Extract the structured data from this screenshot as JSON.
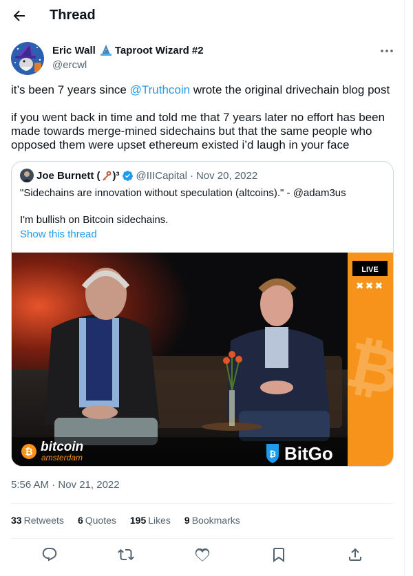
{
  "header": {
    "title": "Thread"
  },
  "author": {
    "name": "Eric Wall",
    "name_suffix": "Taproot Wizard #2",
    "handle": "@ercwl"
  },
  "tweet": {
    "line1_pre": "it’s been 7 years since ",
    "line1_mention": "@Truthcoin",
    "line1_post": " wrote the original drivechain blog post",
    "paragraph2": "if you went back in time and told me that 7 years later no effort has been made towards merge-mined sidechains but that the same people who opposed them were upset ethereum existed i’d laugh in your face"
  },
  "quote": {
    "author_name": "Joe Burnett (",
    "author_name_close": ")³",
    "handle": "@IIICapital",
    "separator": "·",
    "date": "Nov 20, 2022",
    "text1": "\"Sidechains are innovation without speculation (altcoins).\" - @adam3us",
    "text2": "I'm bullish on Bitcoin sidechains.",
    "show_thread": "Show this thread",
    "media": {
      "live_badge": "LIVE",
      "x_marks": "✖✖✖",
      "brand_bitcoin": "bitcoin",
      "brand_amsterdam": "amsterdam",
      "brand_bitgo": "BitGo"
    }
  },
  "timestamp": "5:56 AM · Nov 21, 2022",
  "stats": {
    "retweets_count": "33",
    "retweets_label": "Retweets",
    "quotes_count": "6",
    "quotes_label": "Quotes",
    "likes_count": "195",
    "likes_label": "Likes",
    "bookmarks_count": "9",
    "bookmarks_label": "Bookmarks"
  },
  "colors": {
    "accent": "#1d9bf0",
    "text": "#0f1419",
    "secondary": "#536471",
    "border": "#cfd9de",
    "stage_orange": "#f7931a"
  },
  "icons": [
    "arrow-left-icon",
    "more-icon",
    "wizard-emoji-icon",
    "key-emoji-icon",
    "verified-icon",
    "reply-icon",
    "retweet-icon",
    "like-icon",
    "bookmark-icon",
    "share-icon"
  ]
}
